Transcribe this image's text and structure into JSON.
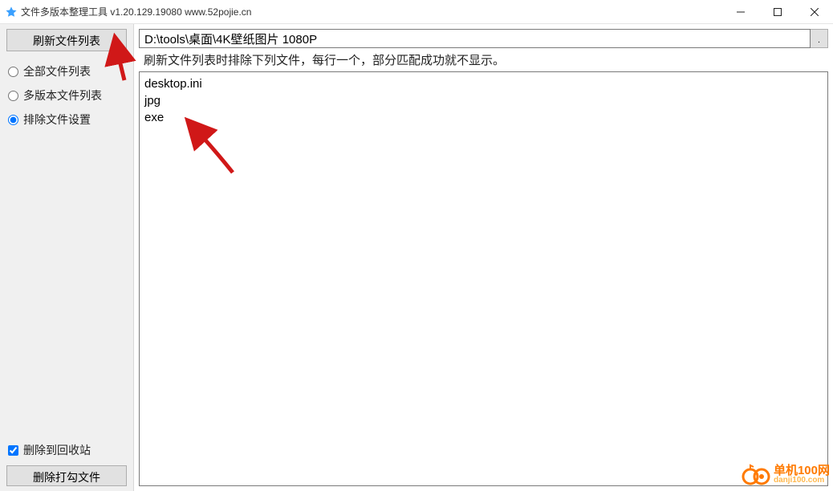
{
  "window": {
    "title": "文件多版本整理工具 v1.20.129.19080 www.52pojie.cn"
  },
  "sidebar": {
    "refresh_label": "刷新文件列表",
    "radios": [
      {
        "label": "全部文件列表",
        "checked": false
      },
      {
        "label": "多版本文件列表",
        "checked": false
      },
      {
        "label": "排除文件设置",
        "checked": true
      }
    ],
    "recycle_checkbox_label": "删除到回收站",
    "recycle_checked": true,
    "delete_label": "删除打勾文件"
  },
  "main": {
    "path_value": "D:\\tools\\桌面\\4K壁纸图片 1080P",
    "browse_label": ".",
    "hint_text": "刷新文件列表时排除下列文件，每行一个，部分匹配成功就不显示。",
    "exclude_text": "desktop.ini\njpg\nexe"
  },
  "watermark": {
    "line1": "单机100网",
    "line2": "danji100.com"
  }
}
